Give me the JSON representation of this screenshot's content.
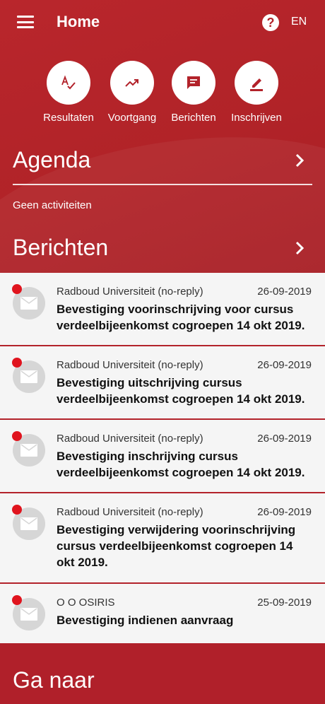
{
  "app": {
    "title": "Home",
    "language": "EN"
  },
  "quick_actions": [
    {
      "label": "Resultaten",
      "icon": "spellcheck-icon"
    },
    {
      "label": "Voortgang",
      "icon": "trending-up-icon"
    },
    {
      "label": "Berichten",
      "icon": "message-icon"
    },
    {
      "label": "Inschrijven",
      "icon": "edit-icon"
    }
  ],
  "agenda": {
    "title": "Agenda",
    "empty_text": "Geen activiteiten"
  },
  "messages_section": {
    "title": "Berichten"
  },
  "messages": [
    {
      "sender": "Radboud Universiteit (no-reply)",
      "date": "26-09-2019",
      "subject": "Bevestiging voorinschrijving voor cursus verdeelbijeenkomst cogroepen 14 okt 2019.",
      "unread": true
    },
    {
      "sender": "Radboud Universiteit (no-reply)",
      "date": "26-09-2019",
      "subject": "Bevestiging uitschrijving cursus verdeelbijeenkomst cogroepen 14 okt 2019.",
      "unread": true
    },
    {
      "sender": "Radboud Universiteit (no-reply)",
      "date": "26-09-2019",
      "subject": "Bevestiging inschrijving cursus verdeelbijeenkomst cogroepen 14 okt 2019.",
      "unread": true
    },
    {
      "sender": "Radboud Universiteit (no-reply)",
      "date": "26-09-2019",
      "subject": "Bevestiging verwijdering voorinschrijving cursus verdeelbijeenkomst cogroepen 14 okt 2019.",
      "unread": true
    },
    {
      "sender": "O O OSIRIS",
      "date": "25-09-2019",
      "subject": "Bevestiging indienen aanvraag",
      "unread": true
    }
  ],
  "goto_section": {
    "title": "Ga naar"
  },
  "colors": {
    "brand": "#b2222a",
    "unread_dot": "#e0141e",
    "card_bg": "#f5f5f5"
  }
}
